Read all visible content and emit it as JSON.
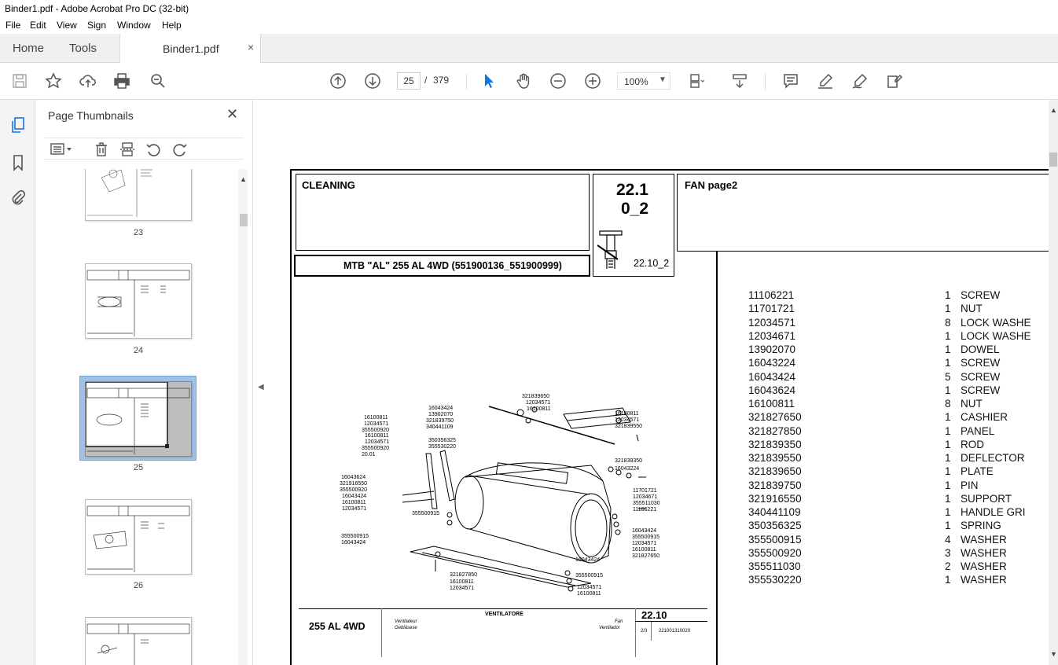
{
  "window": {
    "title": "Binder1.pdf - Adobe Acrobat Pro DC (32-bit)"
  },
  "menu": [
    "File",
    "Edit",
    "View",
    "Sign",
    "Window",
    "Help"
  ],
  "tabs": {
    "home": "Home",
    "tools": "Tools",
    "document": "Binder1.pdf",
    "close": "×"
  },
  "toolbar": {
    "current_page": "25",
    "page_sep": "/",
    "total_pages": "379",
    "zoom": "100%"
  },
  "panel": {
    "title": "Page Thumbnails",
    "close": "✕",
    "thumbnails": [
      {
        "label": "23"
      },
      {
        "label": "24"
      },
      {
        "label": "25",
        "selected": true
      },
      {
        "label": "26"
      }
    ]
  },
  "document": {
    "section": "CLEANING",
    "code_top": "22.1",
    "code_bottom": "0_2",
    "fan_title": "FAN  page2",
    "model": "MTB \"AL\" 255 AL 4WD (551900136_551900999)",
    "ref": "22.10_2",
    "parts": [
      {
        "code": "11106221",
        "qty": "1",
        "desc": "SCREW"
      },
      {
        "code": "11701721",
        "qty": "1",
        "desc": "NUT"
      },
      {
        "code": "12034571",
        "qty": "8",
        "desc": "LOCK WASHE"
      },
      {
        "code": "12034671",
        "qty": "1",
        "desc": "LOCK WASHE"
      },
      {
        "code": "13902070",
        "qty": "1",
        "desc": "DOWEL"
      },
      {
        "code": "16043224",
        "qty": "1",
        "desc": "SCREW"
      },
      {
        "code": "16043424",
        "qty": "5",
        "desc": "SCREW"
      },
      {
        "code": "16043624",
        "qty": "1",
        "desc": "SCREW"
      },
      {
        "code": "16100811",
        "qty": "8",
        "desc": "NUT"
      },
      {
        "code": "321827650",
        "qty": "1",
        "desc": "CASHIER"
      },
      {
        "code": "321827850",
        "qty": "1",
        "desc": "PANEL"
      },
      {
        "code": "321839350",
        "qty": "1",
        "desc": "ROD"
      },
      {
        "code": "321839550",
        "qty": "1",
        "desc": "DEFLECTOR"
      },
      {
        "code": "321839650",
        "qty": "1",
        "desc": "PLATE"
      },
      {
        "code": "321839750",
        "qty": "1",
        "desc": "PIN"
      },
      {
        "code": "321916550",
        "qty": "1",
        "desc": "SUPPORT"
      },
      {
        "code": "340441109",
        "qty": "1",
        "desc": "HANDLE GRI"
      },
      {
        "code": "350356325",
        "qty": "1",
        "desc": "SPRING"
      },
      {
        "code": "355500915",
        "qty": "4",
        "desc": "WASHER"
      },
      {
        "code": "355500920",
        "qty": "3",
        "desc": "WASHER"
      },
      {
        "code": "355511030",
        "qty": "2",
        "desc": "WASHER"
      },
      {
        "code": "355530220",
        "qty": "1",
        "desc": "WASHER"
      }
    ],
    "footer": {
      "model": "255 AL 4WD",
      "name_it": "VENTILATORE",
      "name_fr": "Ventilateur",
      "name_de": "Gebläsese",
      "name_en": "Fan",
      "name_es": "Ventilador",
      "code": "22.10",
      "sheet": "2/3",
      "drawing_no": "221001310020"
    },
    "diagram_labels": [
      "321839650",
      "12034571",
      "16100811",
      "16043424",
      "13902070",
      "321839750",
      "340441109",
      "16100811",
      "12034571",
      "355500920",
      "16100811",
      "12034571",
      "355500920",
      "20.01",
      "350356325",
      "355530220",
      "16100811",
      "12034571",
      "321839550",
      "321839350",
      "16043224",
      "16043624",
      "321916550",
      "355500920",
      "16043424",
      "16100811",
      "12034571",
      "355500915",
      "11701721",
      "12034671",
      "355511030",
      "11106221",
      "355500915",
      "16043424",
      "16043424",
      "355500915",
      "12034571",
      "16100811",
      "321827650",
      "16043424",
      "321827850",
      "355500915",
      "16100811",
      "12034571",
      "12034571",
      "16100811"
    ]
  }
}
